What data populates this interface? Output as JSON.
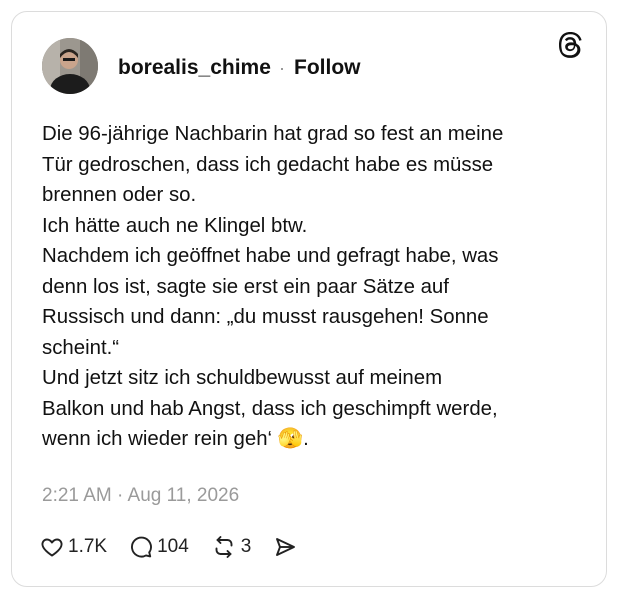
{
  "post": {
    "username": "borealis_chime",
    "separator": "·",
    "follow_label": "Follow",
    "lines": [
      "Die 96-jährige Nachbarin hat grad so fest an meine",
      "Tür gedroschen, dass ich gedacht habe es müsse",
      "brennen oder so.",
      "Ich hätte auch ne Klingel btw.",
      "Nachdem ich geöffnet habe und gefragt habe, was",
      "denn los ist, sagte sie erst ein paar Sätze auf",
      "Russisch und dann: „du musst rausgehen! Sonne",
      "scheint.“",
      "Und jetzt sitz ich schuldbewusst auf meinem",
      "Balkon und hab Angst, dass ich geschimpft werde,",
      "wenn ich wieder rein geh‘ 🫣."
    ],
    "timestamp": "2:21 AM · Aug 11, 2026"
  },
  "actions": {
    "likes": "1.7K",
    "replies": "104",
    "reposts": "3"
  },
  "icons": {
    "logo": "threads-logo-icon",
    "like": "heart-icon",
    "reply": "speech-bubble-icon",
    "repost": "repost-icon",
    "share": "send-icon"
  }
}
